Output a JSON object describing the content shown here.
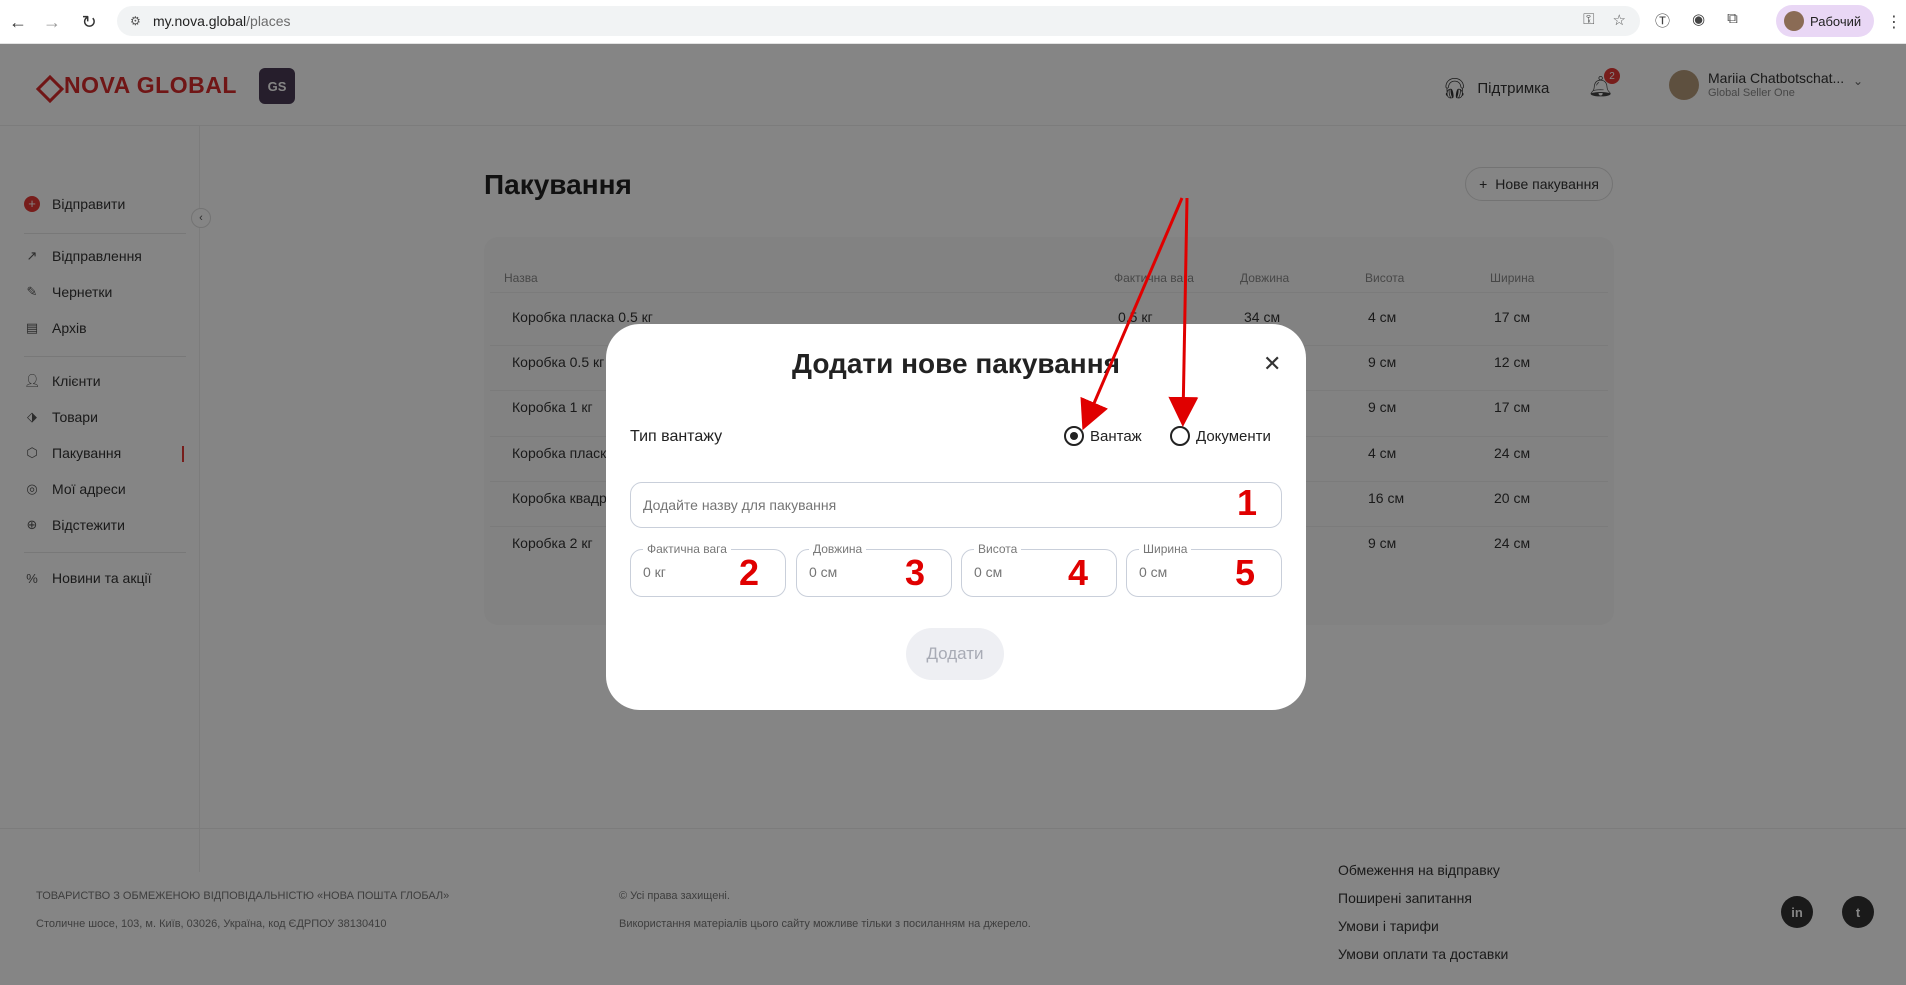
{
  "browser": {
    "url_host": "my.nova.global",
    "url_path": "/places",
    "profile_label": "Рабочий"
  },
  "header": {
    "logo_text": "NOVA GLOBAL",
    "badge": "GS",
    "support_label": "Підтримка",
    "notification_count": "2",
    "user_name": "Mariia Chatbotschat...",
    "user_company": "Global Seller One"
  },
  "sidebar": {
    "send": "Відправити",
    "items_group1": [
      "Відправлення",
      "Чернетки",
      "Архів"
    ],
    "items_group2": [
      "Клієнти",
      "Товари",
      "Пакування",
      "Мої адреси",
      "Відстежити"
    ],
    "items_group3": [
      "Новини та акції"
    ],
    "active": "Пакування"
  },
  "page": {
    "title": "Пакування",
    "new_button": "Нове пакування",
    "columns": [
      "Назва",
      "Фактична вага",
      "Довжина",
      "Висота",
      "Ширина"
    ],
    "rows": [
      {
        "name": "Коробка пласка 0.5 кг",
        "weight": "0.5 кг",
        "length": "34 см",
        "height": "4 см",
        "width": "17 см"
      },
      {
        "name": "Коробка 0.5 кг",
        "weight": "",
        "length": "",
        "height": "9 см",
        "width": "12 см"
      },
      {
        "name": "Коробка 1 кг",
        "weight": "",
        "length": "",
        "height": "9 см",
        "width": "17 см"
      },
      {
        "name": "Коробка пласк",
        "weight": "",
        "length": "",
        "height": "4 см",
        "width": "24 см"
      },
      {
        "name": "Коробка квадр",
        "weight": "",
        "length": "",
        "height": "16 см",
        "width": "20 см"
      },
      {
        "name": "Коробка 2 кг",
        "weight": "",
        "length": "",
        "height": "9 см",
        "width": "24 см"
      }
    ]
  },
  "footer": {
    "company": "ТОВАРИСТВО З ОБМЕЖЕНОЮ ВІДПОВІДАЛЬНІСТЮ «НОВА ПОШТА ГЛОБАЛ»",
    "address": "Столичне шосе, 103, м. Київ, 03026, Україна, код ЄДРПОУ 38130410",
    "rights": "© Усі права захищені.",
    "usage": "Використання матеріалів цього сайту можливе тільки з посиланням на джерело.",
    "links": [
      "Обмеження на відправку",
      "Поширені запитання",
      "Умови і тарифи",
      "Умови оплати та доставки"
    ],
    "social": [
      "in",
      "t"
    ]
  },
  "modal": {
    "title": "Додати нове пакування",
    "cargo_type_label": "Тип вантажу",
    "radio_cargo": "Вантаж",
    "radio_documents": "Документи",
    "selected": "Вантаж",
    "name_placeholder": "Додайте назву для пакування",
    "fields": [
      {
        "label": "Фактична вага",
        "placeholder": "0 кг"
      },
      {
        "label": "Довжина",
        "placeholder": "0 см"
      },
      {
        "label": "Висота",
        "placeholder": "0 см"
      },
      {
        "label": "Ширина",
        "placeholder": "0 см"
      }
    ],
    "submit": "Додати"
  },
  "annotations": {
    "numbers": [
      "1",
      "2",
      "3",
      "4",
      "5"
    ],
    "color": "#e00000"
  }
}
